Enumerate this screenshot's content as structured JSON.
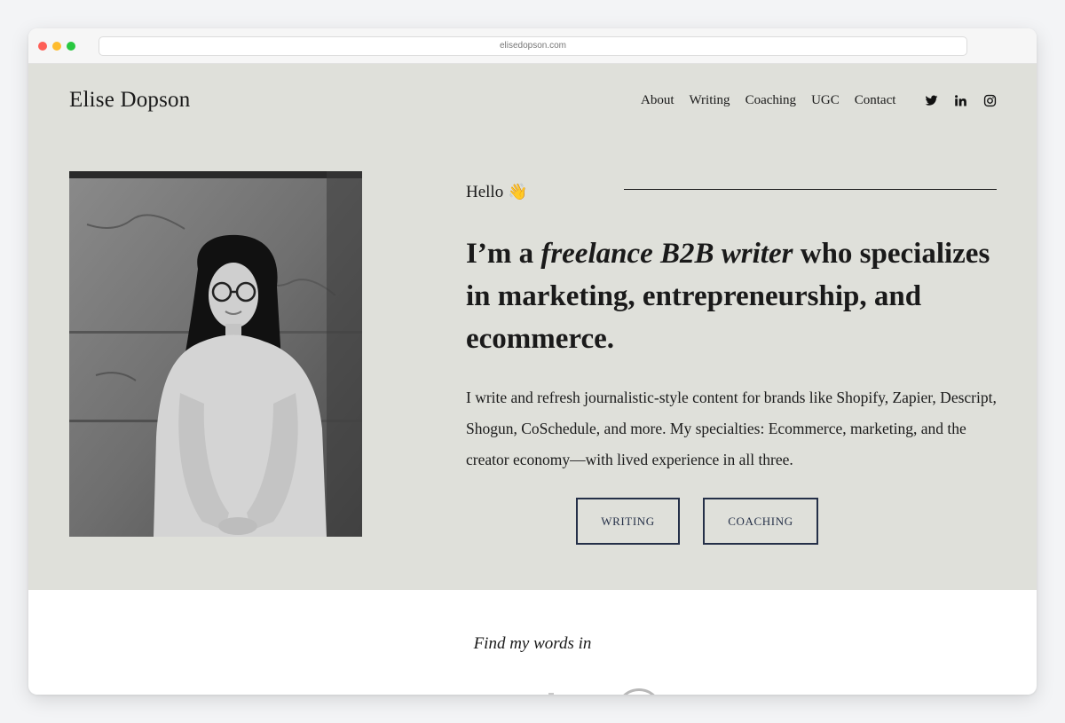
{
  "browser": {
    "url": "elisedopson.com"
  },
  "header": {
    "brand": "Elise Dopson",
    "nav": [
      {
        "label": "About"
      },
      {
        "label": "Writing"
      },
      {
        "label": "Coaching"
      },
      {
        "label": "UGC"
      },
      {
        "label": "Contact"
      }
    ],
    "social_icons": [
      "twitter-icon",
      "linkedin-icon",
      "instagram-icon"
    ]
  },
  "hero": {
    "greeting": "Hello",
    "greeting_emoji": "👋",
    "headline_before": "I’m a ",
    "headline_emphasis": "freelance B2B writer",
    "headline_after": " who specializes in marketing, entrepreneurship, and ecommerce.",
    "intro": "I write and refresh journalistic-style content for brands like Shopify, Zapier, Descript, Shogun, CoSchedule, and more. My specialties: Ecommerce, marketing, and the creator economy—with lived experience in all three.",
    "buttons": {
      "writing": "WRITING",
      "coaching": "COACHING"
    }
  },
  "press": {
    "title": "Find my words in"
  },
  "colors": {
    "hero_background": "#dfe0da",
    "button_border": "#253048",
    "text": "#1a1a1a"
  }
}
